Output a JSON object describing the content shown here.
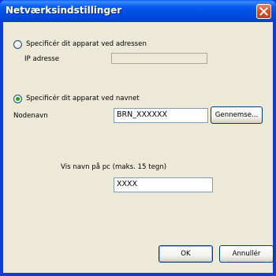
{
  "window": {
    "title": "Netværksindstillinger"
  },
  "option_address": {
    "label": "Specificér dit apparat ved adressen",
    "selected": false,
    "ip_label": "IP adresse",
    "ip_value": ""
  },
  "option_name": {
    "label": "Specificér dit apparat ved navnet",
    "selected": true,
    "node_label": "Nodenavn",
    "node_value": "BRN_XXXXXX",
    "browse_label": "Gennemse..."
  },
  "pc_name": {
    "label": "Vis navn på pc (maks. 15 tegn)",
    "value": "XXXX"
  },
  "buttons": {
    "ok": "OK",
    "cancel": "Annullér"
  },
  "icons": {
    "close": "close-icon"
  }
}
